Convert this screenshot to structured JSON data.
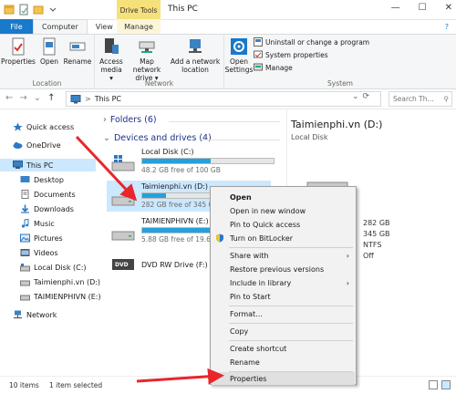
{
  "titlebar": {
    "context_tab": "Drive Tools",
    "window_title": "This PC",
    "minimize": "—",
    "maximize": "☐",
    "close": "✕"
  },
  "ribbon_tabs": {
    "file": "File",
    "computer": "Computer",
    "view": "View",
    "manage": "Manage"
  },
  "ribbon": {
    "location": {
      "label": "Location",
      "properties": "Properties",
      "open": "Open",
      "rename": "Rename"
    },
    "network": {
      "label": "Network",
      "access_media": "Access\nmedia ▾",
      "map_drive": "Map network\ndrive ▾",
      "add_location": "Add a network\nlocation"
    },
    "system": {
      "label": "System",
      "open_settings": "Open\nSettings",
      "uninstall": "Uninstall or change a program",
      "system_properties": "System properties",
      "manage": "Manage"
    }
  },
  "address": {
    "back": "←",
    "forward": "→",
    "recent": "⌄",
    "up": "↑",
    "path_sep": ">",
    "path": "This PC",
    "dropdown": "⌄",
    "refresh": "⟳",
    "search_placeholder": "Search Th...",
    "search_icon": "⚲"
  },
  "nav": {
    "items": [
      {
        "label": "Quick access"
      },
      {
        "label": "OneDrive"
      },
      {
        "label": "This PC"
      },
      {
        "label": "Desktop"
      },
      {
        "label": "Documents"
      },
      {
        "label": "Downloads"
      },
      {
        "label": "Music"
      },
      {
        "label": "Pictures"
      },
      {
        "label": "Videos"
      },
      {
        "label": "Local Disk (C:)"
      },
      {
        "label": "Taimienphi.vn (D:)"
      },
      {
        "label": "TAIMIENPHIVN (E:)"
      },
      {
        "label": "Network"
      }
    ]
  },
  "content": {
    "folders_header": "Folders (6)",
    "devices_header": "Devices and drives (4)",
    "drives": [
      {
        "name": "Local Disk (C:)",
        "free": "48.2 GB free of 100 GB",
        "used_fraction": 0.52
      },
      {
        "name": "Taimienphi.vn (D:)",
        "free": "282 GB free of 345 GB",
        "used_fraction": 0.18
      },
      {
        "name": "TAIMIENPHIVN (E:)",
        "free": "5.88 GB free of 19.6 GB",
        "used_fraction": 0.7
      },
      {
        "name": "DVD RW Drive (F:)",
        "free": "",
        "used_fraction": 0
      }
    ],
    "dvd_label": "DVD"
  },
  "details": {
    "title": "Taimienphi.vn (D:)",
    "subtitle": "Local Disk",
    "values": [
      "282 GB",
      "345 GB",
      "NTFS",
      "Off"
    ]
  },
  "context_menu": {
    "open": "Open",
    "open_new_window": "Open in new window",
    "pin_quick_access": "Pin to Quick access",
    "turn_on_bitlocker": "Turn on BitLocker",
    "share_with": "Share with",
    "restore_versions": "Restore previous versions",
    "include_library": "Include in library",
    "pin_start": "Pin to Start",
    "format": "Format...",
    "copy": "Copy",
    "create_shortcut": "Create shortcut",
    "rename": "Rename",
    "properties": "Properties",
    "submenu_arrow": "›"
  },
  "status": {
    "count": "10 items",
    "selected": "1 item selected"
  },
  "colors": {
    "accent": "#1979ca",
    "drive_fill": "#26a0da",
    "selection": "#cce8ff",
    "arrow": "#e8262d",
    "context_tab": "#f6e07a"
  }
}
